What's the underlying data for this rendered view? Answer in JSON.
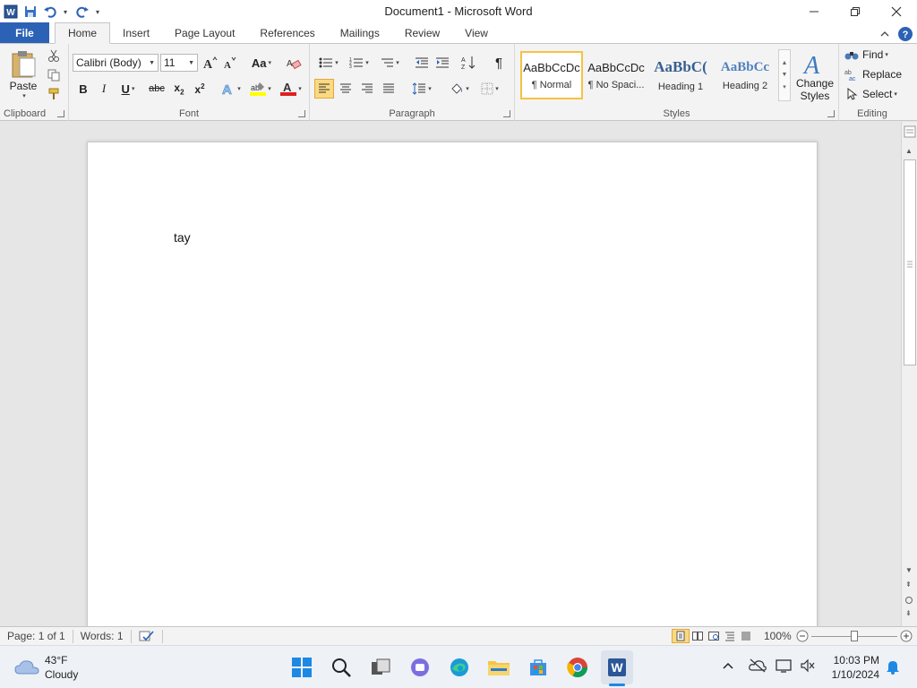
{
  "window": {
    "title": "Document1  -  Microsoft Word"
  },
  "tabs": {
    "file": "File",
    "items": [
      "Home",
      "Insert",
      "Page Layout",
      "References",
      "Mailings",
      "Review",
      "View"
    ]
  },
  "clipboard": {
    "label": "Clipboard",
    "paste": "Paste"
  },
  "font": {
    "label": "Font",
    "name": "Calibri (Body)",
    "size": "11",
    "change_case": "Aa"
  },
  "paragraph": {
    "label": "Paragraph"
  },
  "styles": {
    "label": "Styles",
    "items": [
      {
        "sample": "AaBbCcDc",
        "name": "¶ Normal"
      },
      {
        "sample": "AaBbCcDc",
        "name": "¶ No Spaci..."
      },
      {
        "sample": "AaBbC(",
        "name": "Heading 1"
      },
      {
        "sample": "AaBbCc",
        "name": "Heading 2"
      }
    ],
    "change_styles_line1": "Change",
    "change_styles_line2": "Styles"
  },
  "editing": {
    "label": "Editing",
    "find": "Find",
    "replace": "Replace",
    "select": "Select"
  },
  "document": {
    "text": "tay"
  },
  "status": {
    "page": "Page: 1 of 1",
    "words": "Words: 1",
    "zoom": "100%"
  },
  "taskbar": {
    "temperature": "43°F",
    "condition": "Cloudy",
    "time": "10:03 PM",
    "date": "1/10/2024"
  },
  "colors": {
    "file_tab": "#2b62b6",
    "selected_style_border": "#f5c242",
    "font_color": "#e02020",
    "highlight_color": "#ffff00"
  }
}
